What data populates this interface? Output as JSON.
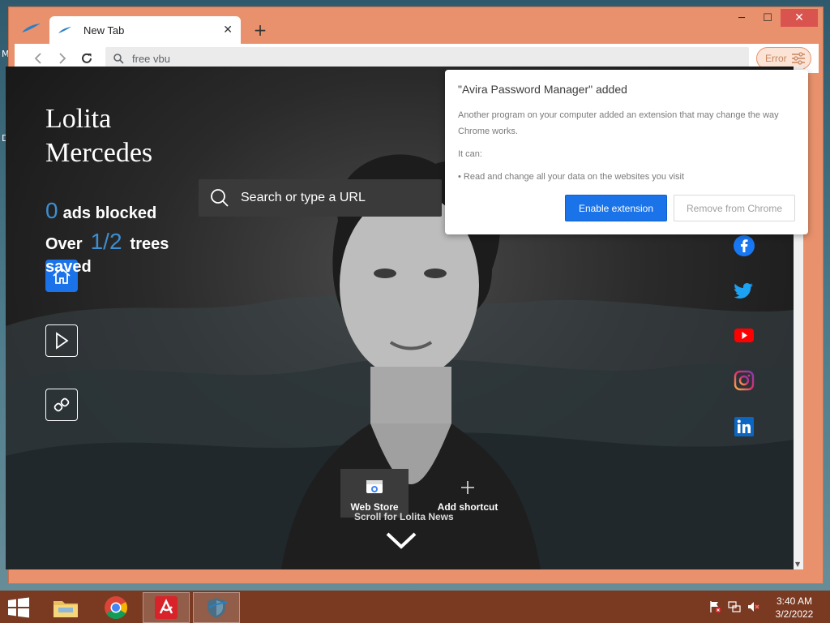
{
  "desktop": {
    "left_letters": [
      "M",
      "D"
    ]
  },
  "browser": {
    "tab_title": "New Tab",
    "new_tab_symbol": "+",
    "window_controls": {
      "minimize": "─",
      "maximize": "☐",
      "close": "✕"
    },
    "address": "free vbu",
    "error_label": "Error"
  },
  "page": {
    "brand_line1": "Lolita",
    "brand_line2": "Mercedes",
    "ads_count": "0",
    "ads_label": "ads blocked",
    "trees_prefix": "Over",
    "trees_count": "1/2",
    "trees_label": "trees",
    "trees_saved": "saved",
    "search_placeholder": "Search or type a URL",
    "shortcuts": [
      {
        "label": "Web Store"
      },
      {
        "label": "Add shortcut"
      }
    ],
    "scroll_news": "Scroll for Lolita News",
    "social": [
      "facebook",
      "twitter",
      "youtube",
      "instagram",
      "linkedin"
    ]
  },
  "popup": {
    "title": "\"Avira Password Manager\" added",
    "body": "Another program on your computer added an extension that may change the way Chrome works.",
    "can_label": "It can:",
    "bullet": "• Read and change all your data on the websites you visit",
    "enable_button": "Enable extension",
    "remove_button": "Remove from Chrome"
  },
  "taskbar": {
    "time": "3:40 AM",
    "date": "3/2/2022"
  },
  "colors": {
    "window_frame": "#e8916c",
    "accent_blue": "#1a73e8",
    "taskbar": "#7a3a22"
  }
}
